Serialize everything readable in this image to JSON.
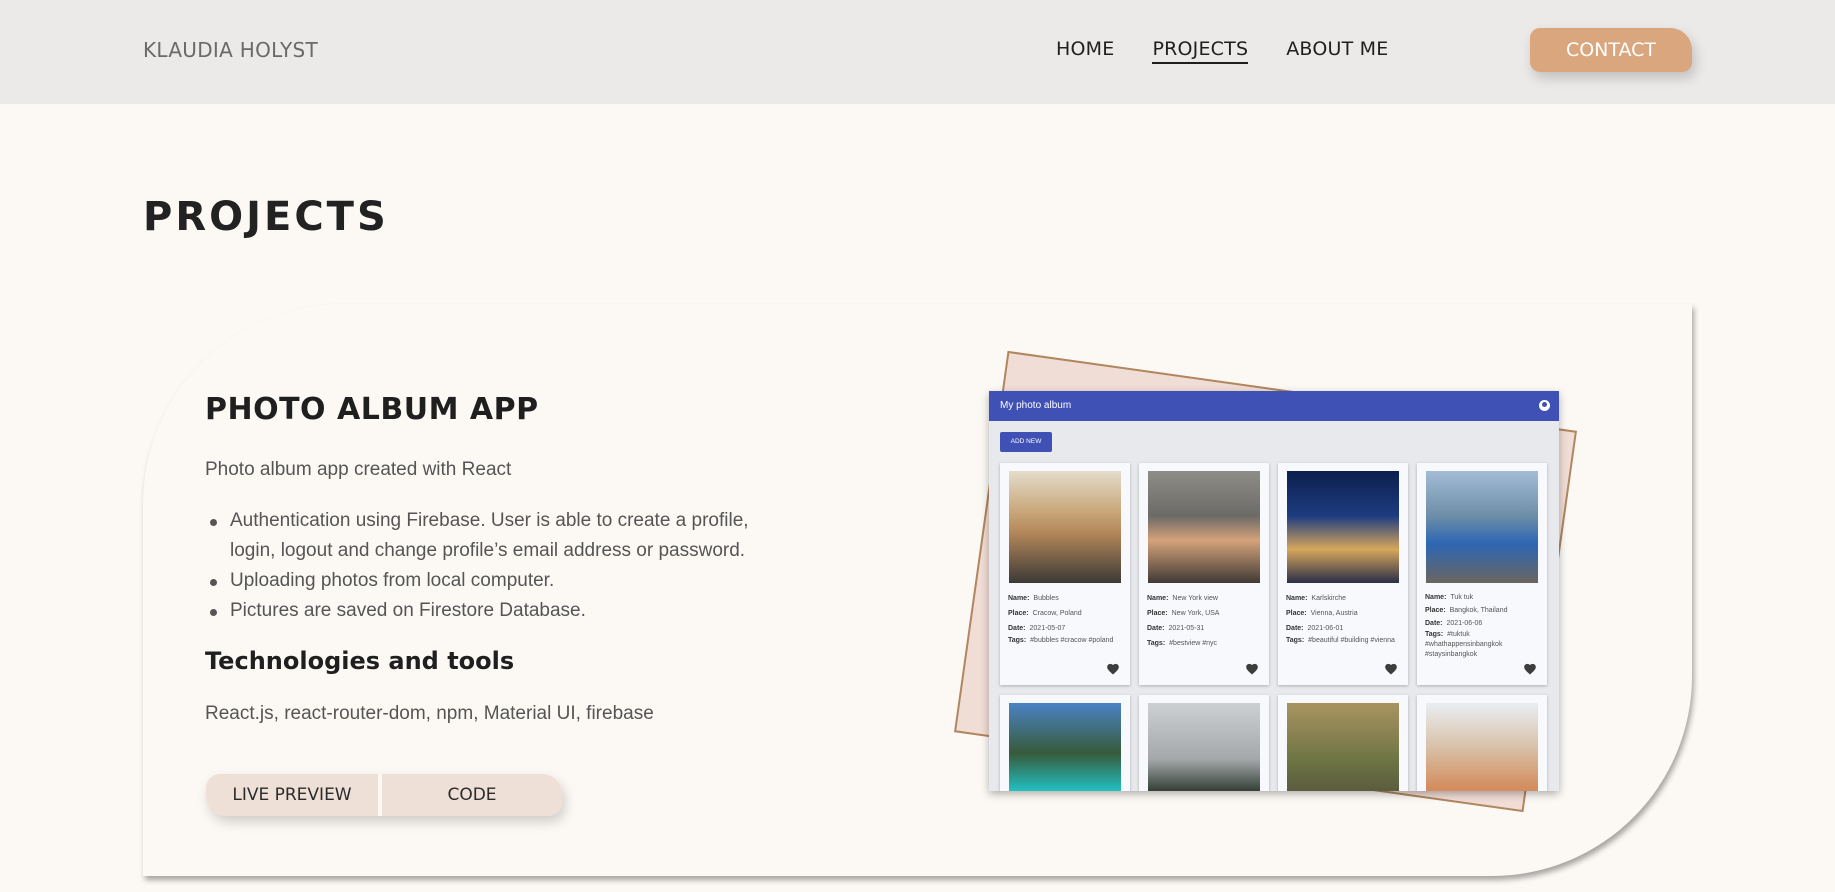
{
  "header": {
    "brand": "KLAUDIA HOLYST",
    "nav": [
      {
        "label": "HOME",
        "active": false
      },
      {
        "label": "PROJECTS",
        "active": true
      },
      {
        "label": "ABOUT ME",
        "active": false
      }
    ],
    "contact_label": "CONTACT"
  },
  "section": {
    "title": "PROJECTS"
  },
  "project": {
    "title": "PHOTO ALBUM APP",
    "description": "Photo album app created with React",
    "features": [
      "Authentication using Firebase. User is able to create a profile, login, logout and change profile’s email address or password.",
      "Uploading photos from local computer.",
      "Pictures are saved on Firestore Database."
    ],
    "tech_title": "Technologies and tools",
    "tech_list": "React.js, react-router-dom, npm, Material UI, firebase",
    "buttons": {
      "live_preview": "LIVE PREVIEW",
      "code": "CODE"
    }
  },
  "preview": {
    "app_title": "My photo album",
    "add_button": "ADD NEW",
    "labels": {
      "name": "Name:",
      "place": "Place:",
      "date": "Date:",
      "tags": "Tags:"
    },
    "photos": [
      {
        "name": "Bubbles",
        "place": "Cracow, Poland",
        "date": "2021-05-07",
        "tags": "#bubbles #cracow #poland"
      },
      {
        "name": "New York view",
        "place": "New York, USA",
        "date": "2021-05-31",
        "tags": "#bestview #nyc"
      },
      {
        "name": "Karlskirche",
        "place": "Vienna, Austria",
        "date": "2021-06-01",
        "tags": "#beautiful #building #vienna"
      },
      {
        "name": "Tuk tuk",
        "place": "Bangkok, Thailand",
        "date": "2021-06-06",
        "tags": "#tuktuk #whathappensinbangkok #staysinbangkok"
      }
    ],
    "colors": {
      "app_bar": "#3f51b5",
      "accent": "#daa67d"
    }
  }
}
